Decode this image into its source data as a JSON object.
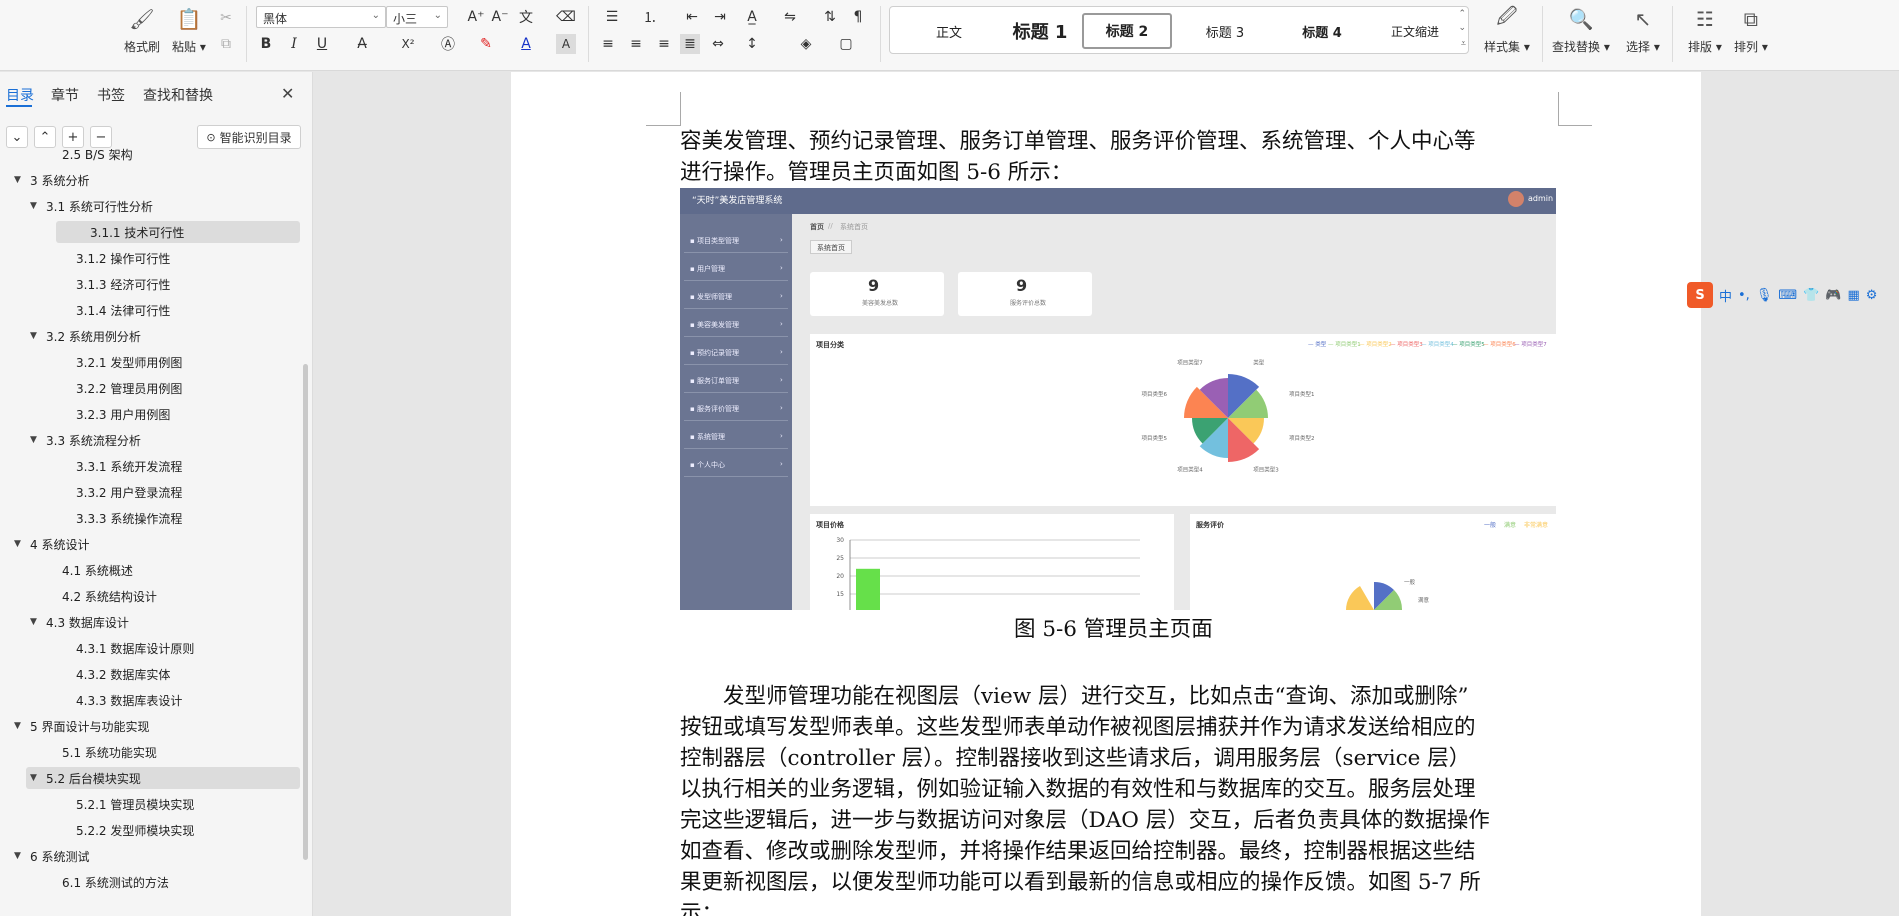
{
  "ribbon": {
    "clipboard": {
      "format_painter": "格式刷",
      "paste": "粘贴"
    },
    "font": {
      "family": "黑体",
      "size": "小三"
    },
    "font_buttons": {
      "bold": "B",
      "italic": "I",
      "underline": "U",
      "superscript": "X²",
      "char_shade": "A"
    },
    "styles": [
      "正文",
      "标题 1",
      "标题 2",
      "标题 3",
      "标题 4",
      "正文缩进"
    ],
    "selected_style": "标题 2",
    "style_set": "样式集",
    "find_replace": "查找替换",
    "select": "选择",
    "layout": "排版",
    "arrange": "排列"
  },
  "nav": {
    "tabs": [
      "目录",
      "章节",
      "书签",
      "查找和替换"
    ],
    "active_tab": "目录",
    "smart_toc": "智能识别目录",
    "toc": [
      {
        "text": "2.5 B/S 架构",
        "level": 2,
        "has_toggle": false,
        "highlighted": false
      },
      {
        "text": "3 系统分析",
        "level": 1,
        "has_toggle": true,
        "highlighted": false
      },
      {
        "text": "3.1  系统可行性分析",
        "level": 2,
        "has_toggle": true,
        "highlighted": false
      },
      {
        "text": "3.1.1  技术可行性",
        "level": 3,
        "has_toggle": false,
        "highlighted": true
      },
      {
        "text": "3.1.2  操作可行性",
        "level": 3,
        "has_toggle": false,
        "highlighted": false
      },
      {
        "text": "3.1.3  经济可行性",
        "level": 3,
        "has_toggle": false,
        "highlighted": false
      },
      {
        "text": "3.1.4  法律可行性",
        "level": 3,
        "has_toggle": false,
        "highlighted": false
      },
      {
        "text": "3.2 系统用例分析",
        "level": 2,
        "has_toggle": true,
        "highlighted": false
      },
      {
        "text": "3.2.1 发型师用例图",
        "level": 3,
        "has_toggle": false,
        "highlighted": false
      },
      {
        "text": "3.2.2 管理员用例图",
        "level": 3,
        "has_toggle": false,
        "highlighted": false
      },
      {
        "text": "3.2.3 用户用例图",
        "level": 3,
        "has_toggle": false,
        "highlighted": false
      },
      {
        "text": "3.3 系统流程分析",
        "level": 2,
        "has_toggle": true,
        "highlighted": false
      },
      {
        "text": "3.3.1  系统开发流程",
        "level": 3,
        "has_toggle": false,
        "highlighted": false
      },
      {
        "text": "3.3.2  用户登录流程",
        "level": 3,
        "has_toggle": false,
        "highlighted": false
      },
      {
        "text": "3.3.3  系统操作流程",
        "level": 3,
        "has_toggle": false,
        "highlighted": false
      },
      {
        "text": "4  系统设计",
        "level": 1,
        "has_toggle": true,
        "highlighted": false
      },
      {
        "text": "4.1  系统概述",
        "level": 2,
        "has_toggle": false,
        "highlighted": false
      },
      {
        "text": "4.2  系统结构设计",
        "level": 2,
        "has_toggle": false,
        "highlighted": false
      },
      {
        "text": "4.3  数据库设计",
        "level": 2,
        "has_toggle": true,
        "highlighted": false
      },
      {
        "text": "4.3.1  数据库设计原则",
        "level": 3,
        "has_toggle": false,
        "highlighted": false
      },
      {
        "text": "4.3.2  数据库实体",
        "level": 3,
        "has_toggle": false,
        "highlighted": false
      },
      {
        "text": "4.3.3  数据库表设计",
        "level": 3,
        "has_toggle": false,
        "highlighted": false
      },
      {
        "text": "5 界面设计与功能实现",
        "level": 1,
        "has_toggle": true,
        "highlighted": false
      },
      {
        "text": "5.1 系统功能实现",
        "level": 2,
        "has_toggle": false,
        "highlighted": false
      },
      {
        "text": "5.2 后台模块实现",
        "level": 2,
        "has_toggle": true,
        "highlighted": true
      },
      {
        "text": "5.2.1 管理员模块实现",
        "level": 3,
        "has_toggle": false,
        "highlighted": false
      },
      {
        "text": "5.2.2 发型师模块实现",
        "level": 3,
        "has_toggle": false,
        "highlighted": false
      },
      {
        "text": "6 系统测试",
        "level": 1,
        "has_toggle": true,
        "highlighted": false
      },
      {
        "text": "6.1 系统测试的方法",
        "level": 2,
        "has_toggle": false,
        "highlighted": false
      }
    ]
  },
  "doc": {
    "para1": [
      "容美发管理、预约记录管理、服务订单管理、服务评价管理、系统管理、个人中心等",
      "进行操作。管理员主页面如图 5-6 所示："
    ],
    "caption": "图 5-6 管理员主页面",
    "para2": [
      "　　发型师管理功能在视图层（view 层）进行交互，比如点击“查询、添加或删除”",
      "按钮或填写发型师表单。这些发型师表单动作被视图层捕获并作为请求发送给相应的",
      "控制器层（controller 层）。控制器接收到这些请求后，调用服务层（service 层）",
      "以执行相关的业务逻辑，例如验证输入数据的有效性和与数据库的交互。服务层处理",
      "完这些逻辑后，进一步与数据访问对象层（DAO 层）交互，后者负责具体的数据操作",
      "如查看、修改或删除发型师，并将操作结果返回给控制器。最终，控制器根据这些结",
      "果更新视图层，以便发型师功能可以看到最新的信息或相应的操作反馈。如图 5-7 所",
      "示："
    ]
  },
  "admin_shot": {
    "title": "“天时”美发店管理系统",
    "user": "admin",
    "menu": [
      "项目类型管理",
      "用户管理",
      "发型师管理",
      "美容美发管理",
      "预约记录管理",
      "服务订单管理",
      "服务评价管理",
      "系统管理",
      "个人中心"
    ],
    "breadcrumb": [
      "首页",
      "//",
      "系统首页"
    ],
    "tab": "系统首页",
    "stats": [
      {
        "value": "9",
        "label": "美容美发总数"
      },
      {
        "value": "9",
        "label": "服务评价总数"
      }
    ],
    "pie_panel_title": "项目分类",
    "price_panel_title": "项目价格",
    "review_panel_title": "服务评价",
    "review_legend": [
      "一般",
      "满意",
      "非常满意"
    ],
    "review_labels": [
      "一般",
      "满意"
    ],
    "colors": [
      "#5470c6",
      "#91cc75",
      "#fac858",
      "#ee6666",
      "#73c0de",
      "#3ba272",
      "#fc8452",
      "#9a60b4"
    ],
    "bar_color": "#66e04a"
  },
  "chart_data": [
    {
      "type": "pie",
      "title": "项目分类",
      "categories": [
        "类型",
        "项目类型1",
        "项目类型2",
        "项目类型3",
        "项目类型4",
        "项目类型5",
        "项目类型6",
        "项目类型7"
      ],
      "values": [
        1,
        1,
        1,
        1,
        1,
        1,
        1,
        1
      ]
    },
    {
      "type": "bar",
      "title": "项目价格",
      "ylim": [
        0,
        30
      ],
      "yticks": [
        30,
        25,
        20,
        15
      ],
      "values": [
        22
      ]
    }
  ]
}
